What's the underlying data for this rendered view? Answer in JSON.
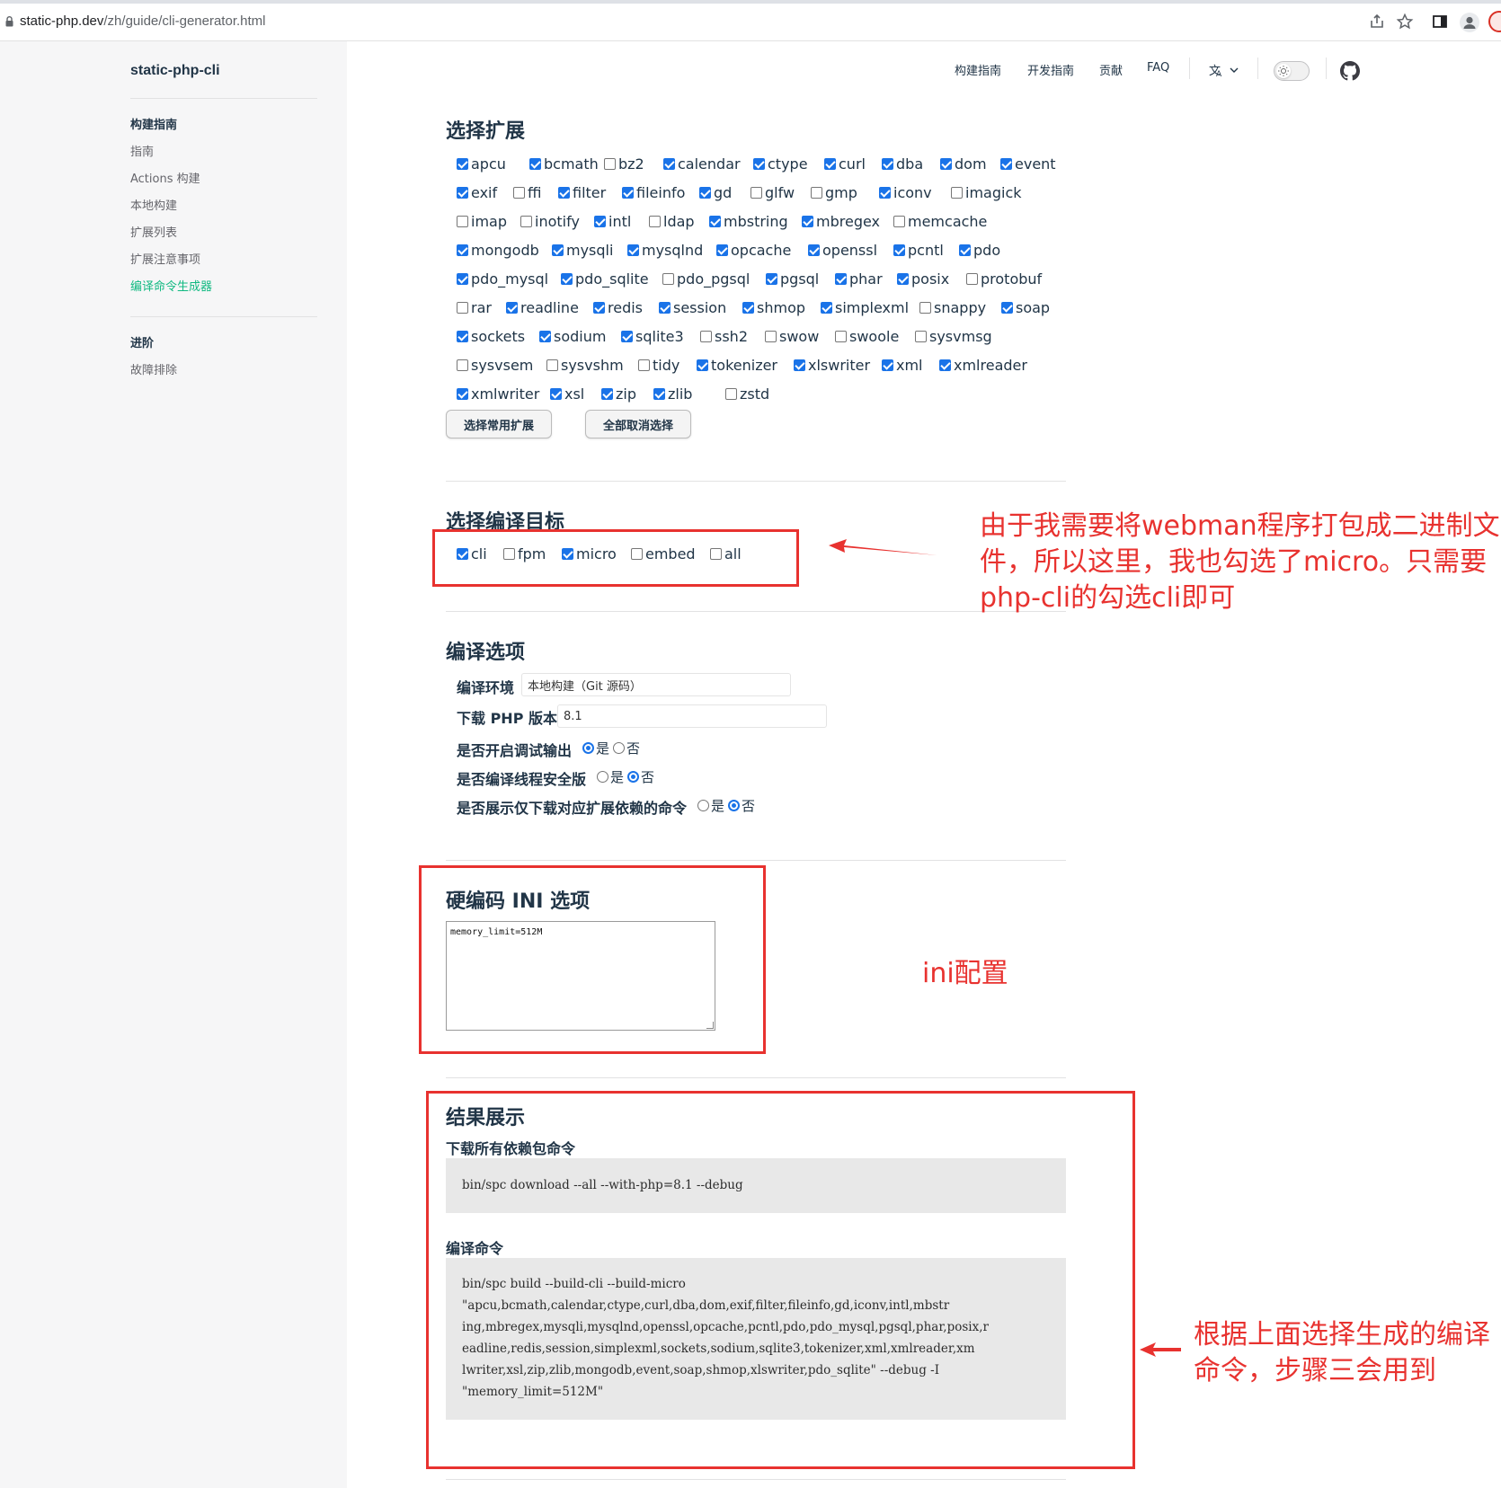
{
  "browser": {
    "url_host": "static-php.dev",
    "url_path": "/zh/guide/cli-generator.html"
  },
  "sidebar": {
    "site_title": "static-php-cli",
    "group1_title": "构建指南",
    "group1_items": [
      "指南",
      "Actions 构建",
      "本地构建",
      "扩展列表",
      "扩展注意事项",
      "编译命令生成器"
    ],
    "active_item": "编译命令生成器",
    "group2_title": "进阶",
    "group2_items": [
      "故障排除"
    ]
  },
  "topnav": {
    "items": [
      "构建指南",
      "开发指南",
      "贡献",
      "FAQ"
    ],
    "lang_icon": "translate-icon",
    "theme_toggle_icon": "sun-icon",
    "github_icon": "github-icon"
  },
  "extensions": {
    "title": "选择扩展",
    "rows": [
      [
        [
          "apcu",
          true
        ],
        [
          "bcmath",
          true
        ],
        [
          "bz2",
          false
        ],
        [
          "calendar",
          true
        ],
        [
          "ctype",
          true
        ],
        [
          "curl",
          true
        ],
        [
          "dba",
          true
        ],
        [
          "dom",
          true
        ],
        [
          "event",
          true
        ]
      ],
      [
        [
          "exif",
          true
        ],
        [
          "ffi",
          false
        ],
        [
          "filter",
          true
        ],
        [
          "fileinfo",
          true
        ],
        [
          "gd",
          true
        ],
        [
          "glfw",
          false
        ],
        [
          "gmp",
          false
        ],
        [
          "iconv",
          true
        ],
        [
          "imagick",
          false
        ]
      ],
      [
        [
          "imap",
          false
        ],
        [
          "inotify",
          false
        ],
        [
          "intl",
          true
        ],
        [
          "ldap",
          false
        ],
        [
          "mbstring",
          true
        ],
        [
          "mbregex",
          true
        ],
        [
          "memcache",
          false
        ]
      ],
      [
        [
          "mongodb",
          true
        ],
        [
          "mysqli",
          true
        ],
        [
          "mysqlnd",
          true
        ],
        [
          "opcache",
          true
        ],
        [
          "openssl",
          true
        ],
        [
          "pcntl",
          true
        ],
        [
          "pdo",
          true
        ]
      ],
      [
        [
          "pdo_mysql",
          true
        ],
        [
          "pdo_sqlite",
          true
        ],
        [
          "pdo_pgsql",
          false
        ],
        [
          "pgsql",
          true
        ],
        [
          "phar",
          true
        ],
        [
          "posix",
          true
        ],
        [
          "protobuf",
          false
        ]
      ],
      [
        [
          "rar",
          false
        ],
        [
          "readline",
          true
        ],
        [
          "redis",
          true
        ],
        [
          "session",
          true
        ],
        [
          "shmop",
          true
        ],
        [
          "simplexml",
          true
        ],
        [
          "snappy",
          false
        ],
        [
          "soap",
          true
        ]
      ],
      [
        [
          "sockets",
          true
        ],
        [
          "sodium",
          true
        ],
        [
          "sqlite3",
          true
        ],
        [
          "ssh2",
          false
        ],
        [
          "swow",
          false
        ],
        [
          "swoole",
          false
        ],
        [
          "sysvmsg",
          false
        ]
      ],
      [
        [
          "sysvsem",
          false
        ],
        [
          "sysvshm",
          false
        ],
        [
          "tidy",
          false
        ],
        [
          "tokenizer",
          true
        ],
        [
          "xlswriter",
          true
        ],
        [
          "xml",
          true
        ],
        [
          "xmlreader",
          true
        ]
      ],
      [
        [
          "xmlwriter",
          true
        ],
        [
          "xsl",
          true
        ],
        [
          "zip",
          true
        ],
        [
          "zlib",
          true
        ],
        [
          "zstd",
          false
        ]
      ]
    ],
    "btn_common": "选择常用扩展",
    "btn_clear": "全部取消选择"
  },
  "targets": {
    "title": "选择编译目标",
    "items": [
      [
        "cli",
        true
      ],
      [
        "fpm",
        false
      ],
      [
        "micro",
        true
      ],
      [
        "embed",
        false
      ],
      [
        "all",
        false
      ]
    ]
  },
  "options": {
    "title": "编译选项",
    "env_label": "编译环境",
    "env_value": "本地构建（Git 源码）",
    "php_label": "下载 PHP 版本",
    "php_value": "8.1",
    "debug_label": "是否开启调试输出",
    "zts_label": "是否编译线程安全版",
    "dl_label": "是否展示仅下载对应扩展依赖的命令",
    "yes": "是",
    "no": "否",
    "debug": "yes",
    "zts": "no",
    "dl": "no"
  },
  "ini": {
    "title": "硬编码 INI 选项",
    "value": "memory_limit=512M"
  },
  "result": {
    "title": "结果展示",
    "download_label": "下载所有依赖包命令",
    "download_cmd": "bin/spc download --all --with-php=8.1 --debug",
    "build_label": "编译命令",
    "build_lines": [
      "bin/spc build --build-cli --build-micro",
      "\"apcu,bcmath,calendar,ctype,curl,dba,dom,exif,filter,fileinfo,gd,iconv,intl,mbstr",
      "ing,mbregex,mysqli,mysqlnd,openssl,opcache,pcntl,pdo,pdo_mysql,pgsql,phar,posix,r",
      "eadline,redis,session,simplexml,sockets,sodium,sqlite3,tokenizer,xml,xmlreader,xm",
      "lwriter,xsl,zip,zlib,mongodb,event,soap,shmop,xlswriter,pdo_sqlite\" --debug -I",
      "\"memory_limit=512M\""
    ]
  },
  "annotations": {
    "note_micro": [
      "由于我需要将webman程序打包成二进制文",
      "件，所以这里，我也勾选了micro。只需要",
      "php-cli的勾选cli即可"
    ],
    "note_ini": "ini配置",
    "note_result": [
      "根据上面选择生成的编译",
      "命令，步骤三会用到"
    ],
    "accent_color": "#e8322f"
  }
}
